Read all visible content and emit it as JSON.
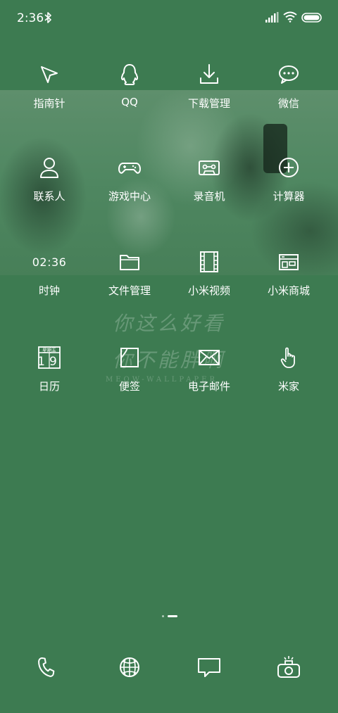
{
  "status_bar": {
    "time": "2:36",
    "icons": [
      "bluetooth-icon",
      "signal-icon",
      "wifi-icon",
      "battery-icon"
    ]
  },
  "theme": {
    "background": "#3d7b51",
    "foreground": "#ffffff"
  },
  "apps": [
    {
      "label": "指南针",
      "icon": "compass-arrow-icon"
    },
    {
      "label": "QQ",
      "icon": "qq-penguin-icon"
    },
    {
      "label": "下载管理",
      "icon": "download-icon"
    },
    {
      "label": "微信",
      "icon": "wechat-bubble-icon"
    },
    {
      "label": "联系人",
      "icon": "contact-person-icon"
    },
    {
      "label": "游戏中心",
      "icon": "gamepad-icon"
    },
    {
      "label": "录音机",
      "icon": "cassette-icon"
    },
    {
      "label": "计算器",
      "icon": "calculator-plus-icon"
    },
    {
      "label": "时钟",
      "icon": "clock-digital",
      "display": "02:36"
    },
    {
      "label": "文件管理",
      "icon": "folder-icon"
    },
    {
      "label": "小米视频",
      "icon": "film-strip-icon"
    },
    {
      "label": "小米商城",
      "icon": "store-icon"
    },
    {
      "label": "日历",
      "icon": "calendar-icon",
      "weekday": "星期五",
      "day": "19"
    },
    {
      "label": "便签",
      "icon": "note-icon"
    },
    {
      "label": "电子邮件",
      "icon": "mail-icon"
    },
    {
      "label": "米家",
      "icon": "hand-pointer-icon"
    }
  ],
  "wallpaper_text": {
    "line1": "你这么好看",
    "line2": "你不能胖啊",
    "line3": "MEOW-WALLPAPER"
  },
  "page_indicator": {
    "pages": 2,
    "current": 2
  },
  "dock": [
    "phone-icon",
    "browser-globe-icon",
    "message-icon",
    "camera-icon"
  ]
}
